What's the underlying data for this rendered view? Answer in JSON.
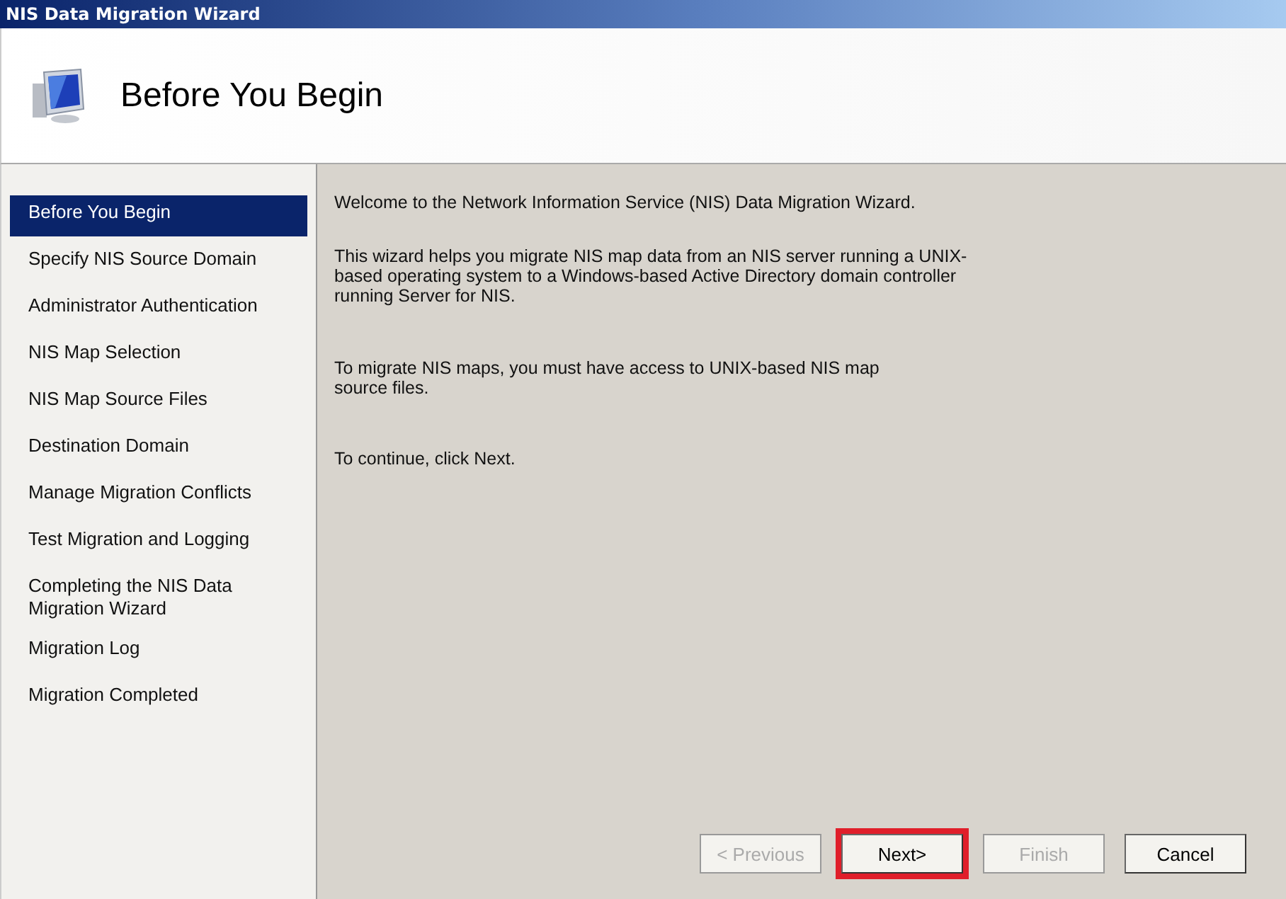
{
  "window": {
    "title": "NIS Data Migration Wizard"
  },
  "header": {
    "title": "Before You Begin"
  },
  "steps": [
    {
      "label": "Before You Begin",
      "selected": true
    },
    {
      "label": "Specify NIS Source Domain",
      "selected": false
    },
    {
      "label": "Administrator Authentication",
      "selected": false
    },
    {
      "label": "NIS Map Selection",
      "selected": false
    },
    {
      "label": "NIS Map Source Files",
      "selected": false
    },
    {
      "label": "Destination Domain",
      "selected": false
    },
    {
      "label": "Manage Migration Conflicts",
      "selected": false
    },
    {
      "label": "Test Migration and Logging",
      "selected": false
    },
    {
      "label": "Completing the NIS Data Migration Wizard",
      "selected": false
    },
    {
      "label": "Migration Log",
      "selected": false
    },
    {
      "label": "Migration Completed",
      "selected": false
    }
  ],
  "paragraphs": [
    "Welcome to the Network Information Service (NIS) Data Migration Wizard.",
    "This wizard helps you migrate NIS map data from an NIS server running a UNIX-based operating system to a Windows-based Active Directory domain controller running Server for NIS.",
    "To migrate NIS maps, you must have access to UNIX-based NIS map source files.",
    "To continue, click Next."
  ],
  "buttons": [
    {
      "label": "< Previous",
      "disabled": true,
      "highlighted": false
    },
    {
      "label": "Next>",
      "disabled": false,
      "highlighted": true
    },
    {
      "label": "Finish",
      "disabled": true,
      "highlighted": false
    },
    {
      "label": "Cancel",
      "disabled": false,
      "highlighted": false
    }
  ]
}
